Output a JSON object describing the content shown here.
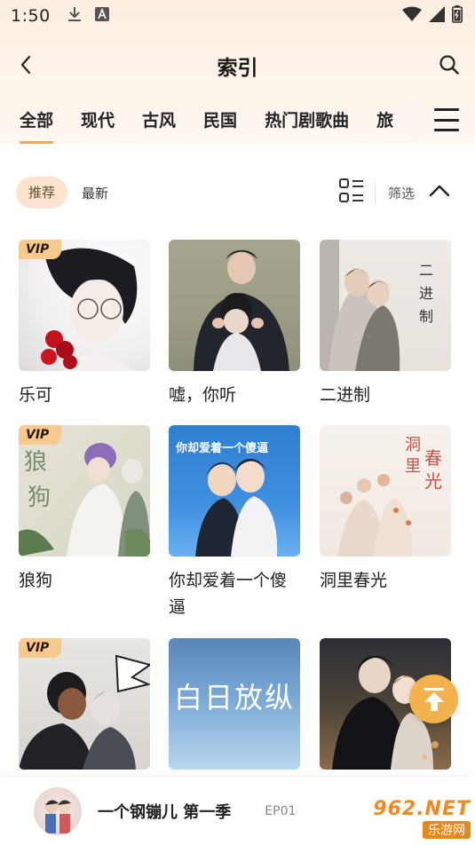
{
  "status_bar": {
    "time": "1:50",
    "icons": [
      "download-icon",
      "font-icon",
      "wifi-icon",
      "signal-icon",
      "battery-icon"
    ]
  },
  "navbar": {
    "title": "索引",
    "back_icon": "chevron-left-icon",
    "search_icon": "search-icon"
  },
  "tabs": [
    {
      "label": "全部",
      "active": true
    },
    {
      "label": "现代",
      "active": false
    },
    {
      "label": "古风",
      "active": false
    },
    {
      "label": "民国",
      "active": false
    },
    {
      "label": "热门剧歌曲",
      "active": false
    },
    {
      "label": "旅",
      "active": false
    }
  ],
  "menu_icon": "hamburger-menu-icon",
  "filters": {
    "sort_options": [
      {
        "label": "推荐",
        "active": true
      },
      {
        "label": "最新",
        "active": false
      }
    ],
    "view_toggle_icon": "grid-list-icon",
    "filter_label": "筛选",
    "collapse_icon": "chevron-up-icon"
  },
  "items": [
    {
      "title": "乐可",
      "vip": true,
      "vip_label": "VIP"
    },
    {
      "title": "嘘，你听",
      "vip": false
    },
    {
      "title": "二进制",
      "vip": false
    },
    {
      "title": "狼狗",
      "vip": true,
      "vip_label": "VIP"
    },
    {
      "title": "你却爱着一个傻逼",
      "vip": false
    },
    {
      "title": "洞里春光",
      "vip": false
    },
    {
      "title": "",
      "vip": true,
      "vip_label": "VIP"
    },
    {
      "title": "",
      "vip": false,
      "cover_text": "白日放纵"
    },
    {
      "title": "",
      "vip": false
    }
  ],
  "fab_icon": "scroll-to-top-icon",
  "colors": {
    "accent": "#f3a75a",
    "pill_bg": "#fbe4cf",
    "vip_bg": "#f6c98f",
    "fab": "#f2b24c",
    "header_bg": "#fbeee0"
  },
  "player": {
    "title": "一个钢镚儿 第一季",
    "episode": "EP01"
  },
  "watermark": {
    "top": "962.NET",
    "bottom": "乐游网"
  }
}
